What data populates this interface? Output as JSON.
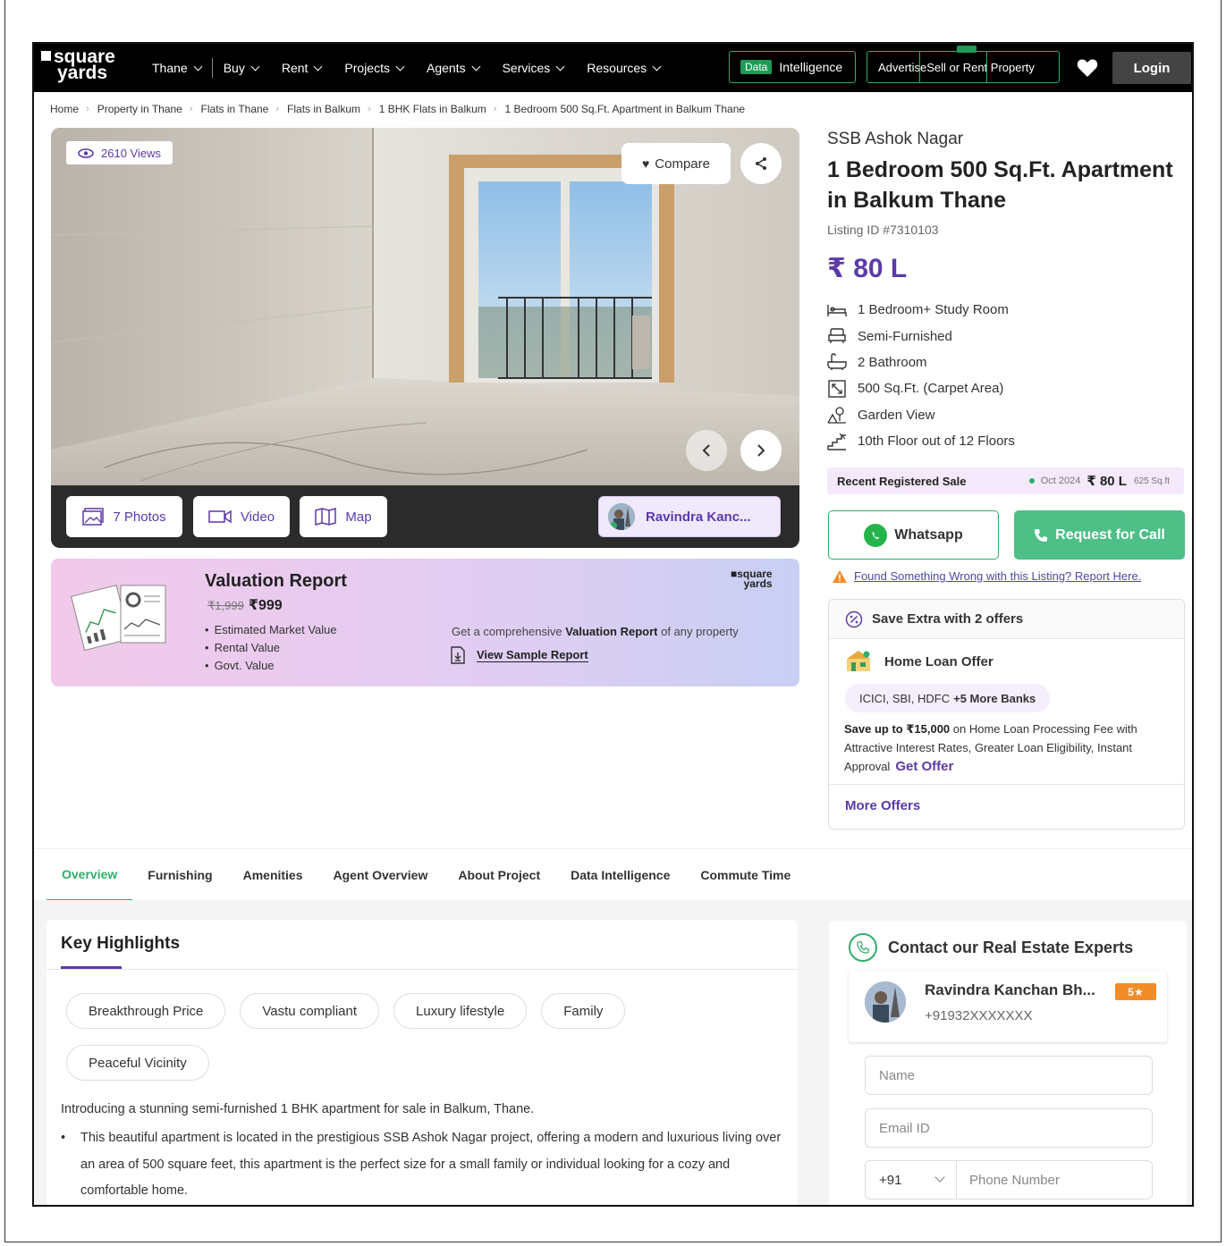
{
  "nav": {
    "logo_line1": "square",
    "logo_line2": "yards",
    "items": [
      {
        "label": "Thane"
      },
      {
        "label": "Buy"
      },
      {
        "label": "Rent"
      },
      {
        "label": "Projects"
      },
      {
        "label": "Agents"
      },
      {
        "label": "Services"
      },
      {
        "label": "Resources"
      }
    ],
    "data_tag": "Data",
    "data_label": "Intelligence",
    "advertise_label": "Advertise",
    "sell_label": "Sell",
    "or_label": "or",
    "rent_property_label": "Rent Property",
    "login_label": "Login"
  },
  "breadcrumb": [
    "Home",
    "Property in Thane",
    "Flats in Thane",
    "Flats in Balkum",
    "1 BHK Flats in Balkum",
    "1 Bedroom 500 Sq.Ft. Apartment in Balkum Thane"
  ],
  "gallery": {
    "views": "2610 Views",
    "compare_label": "Compare",
    "photos_label": "7 Photos",
    "video_label": "Video",
    "map_label": "Map",
    "agent_label": "Ravindra Kanc..."
  },
  "valuation": {
    "title": "Valuation Report",
    "old_price": "₹1,999",
    "price": "₹999",
    "items": [
      "Estimated Market Value",
      "Rental Value",
      "Govt. Value"
    ],
    "logo_line1": "square",
    "logo_line2": "yards",
    "desc_prefix": "Get a comprehensive ",
    "desc_bold": "Valuation Report",
    "desc_suffix": " of any property",
    "link_label": "View Sample Report"
  },
  "listing": {
    "project": "SSB Ashok Nagar",
    "title": "1 Bedroom 500 Sq.Ft. Apartment in Balkum Thane",
    "listing_id": "Listing ID #7310103",
    "price": "₹ 80 L",
    "features": [
      {
        "icon": "bed-icon",
        "label": "1 Bedroom+ Study Room"
      },
      {
        "icon": "sofa-icon",
        "label": "Semi-Furnished"
      },
      {
        "icon": "bathtub-icon",
        "label": "2 Bathroom"
      },
      {
        "icon": "area-icon",
        "label": "500 Sq.Ft. (Carpet Area)"
      },
      {
        "icon": "garden-icon",
        "label": "Garden View"
      },
      {
        "icon": "floor-icon",
        "label": "10th Floor out of 12 Floors"
      }
    ],
    "recent_sale_label": "Recent Registered Sale",
    "recent_sale_date": "Oct 2024",
    "recent_sale_amount": "₹ 80 L",
    "recent_sale_area": "625 Sq.ft",
    "whatsapp_label": "Whatsapp",
    "call_label": "Request for Call",
    "report_label": "Found Something Wrong with this Listing? Report Here."
  },
  "offers": {
    "title": "Save Extra with 2 offers",
    "home_loan": "Home Loan Offer",
    "banks": "ICICI, SBI, HDFC",
    "banks_more": "+5 More Banks",
    "save_bold": "Save up to ₹15,000",
    "save_text": " on Home Loan Processing Fee with Attractive Interest Rates, Greater Loan Eligibility, Instant Approval",
    "get_offer": "Get Offer",
    "more_offers": "More Offers"
  },
  "tabs": [
    "Overview",
    "Furnishing",
    "Amenities",
    "Agent Overview",
    "About Project",
    "Data Intelligence",
    "Commute Time"
  ],
  "highlights": {
    "title": "Key Highlights",
    "chips": [
      "Breakthrough Price",
      "Vastu compliant",
      "Luxury lifestyle",
      "Family",
      "Peaceful Vicinity"
    ],
    "intro": "Introducing a stunning semi-furnished 1 BHK apartment for sale in Balkum, Thane.",
    "bullet": "This beautiful apartment is located in the prestigious SSB Ashok Nagar project, offering a modern and luxurious living over an area of 500 square feet, this apartment is the perfect size for a small family or individual looking for a cozy and comfortable home."
  },
  "contact": {
    "title": "Contact our Real Estate Experts",
    "agent_name": "Ravindra Kanchan Bh...",
    "rating": "5★",
    "agent_phone": "+91932XXXXXXX",
    "name_placeholder": "Name",
    "email_placeholder": "Email ID",
    "country_code": "+91",
    "phone_placeholder": "Phone Number"
  },
  "colors": {
    "brand_purple": "#5b3aa8",
    "accent_green": "#2fae6a",
    "call_green": "#4dbf87",
    "rating_orange": "#f28c28"
  }
}
